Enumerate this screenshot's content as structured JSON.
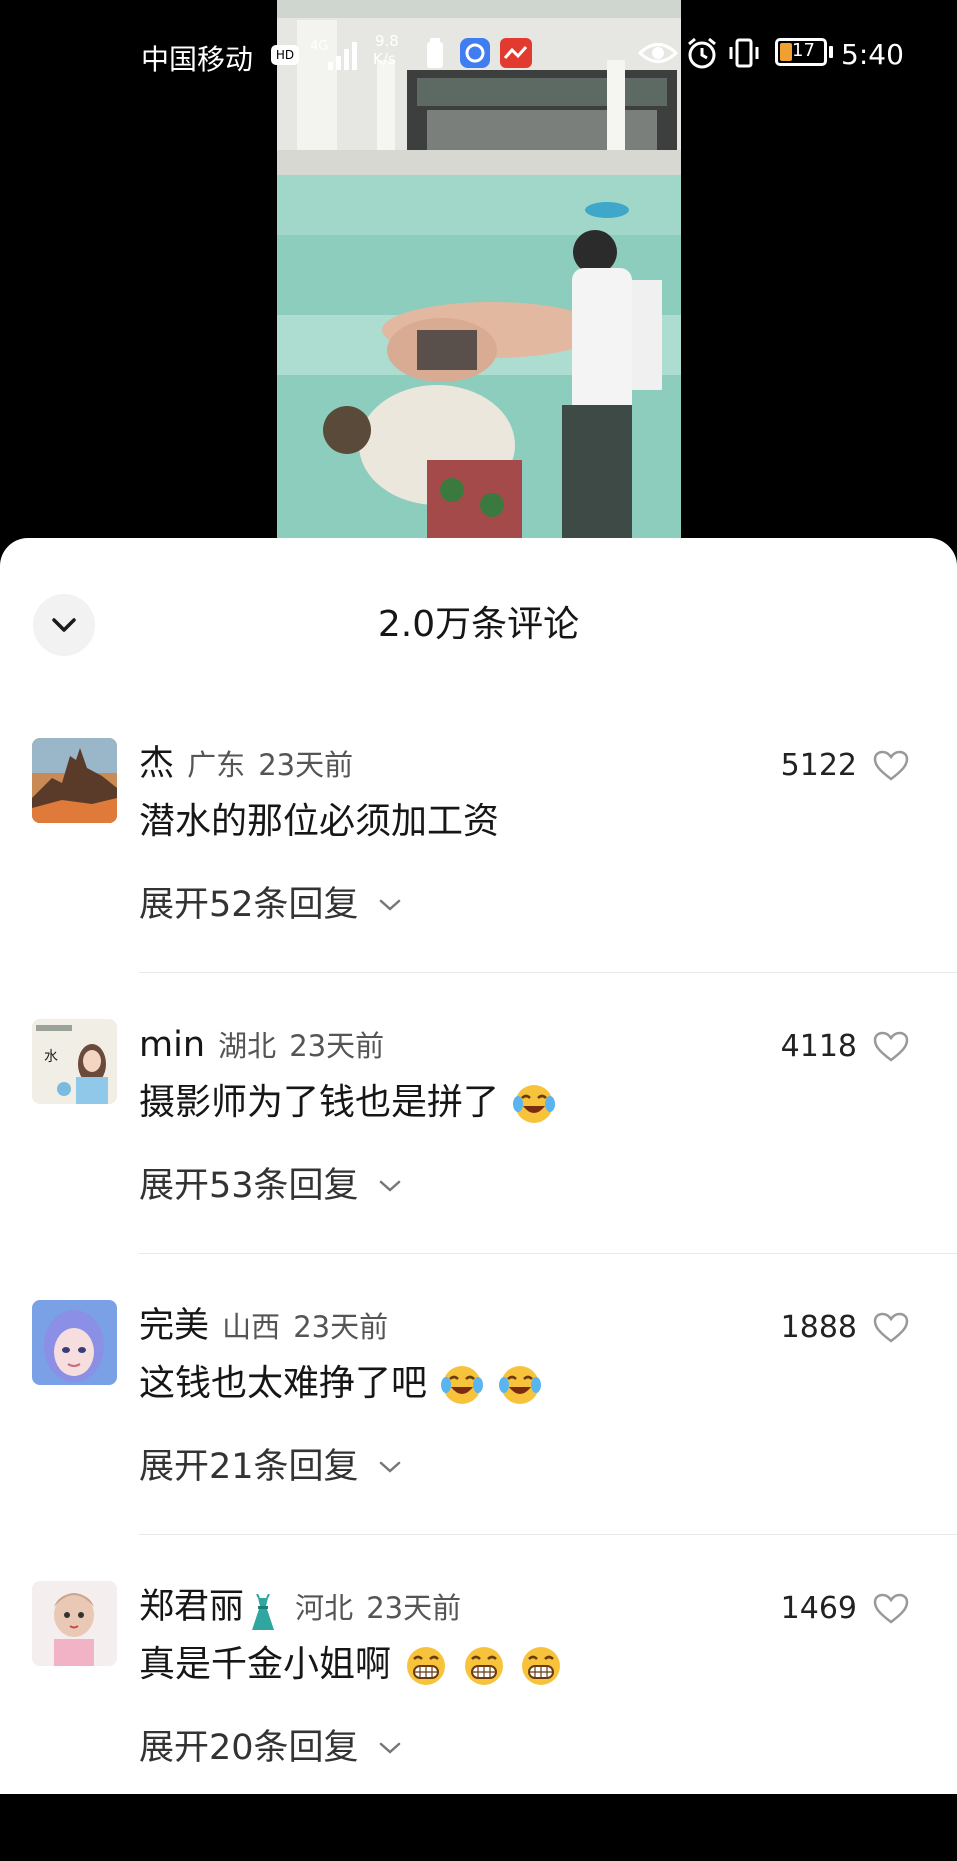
{
  "status_bar": {
    "carrier": "中国移动",
    "hd_badge": "HD",
    "network_type": "4G",
    "speed_value": "9.8",
    "speed_unit": "K/s",
    "battery_level": "17",
    "time": "5:40"
  },
  "comments_panel": {
    "title": "2.0万条评论",
    "collapse_icon": "chevron-down-icon"
  },
  "comments": [
    {
      "username": "杰",
      "region": "广东",
      "time_ago": "23天前",
      "likes": "5122",
      "text": "潜水的那位必须加工资",
      "text_emojis": [],
      "replies_label": "展开52条回复",
      "avatar": "desert-rock-landscape"
    },
    {
      "username": "min",
      "region": "湖北",
      "time_ago": "23天前",
      "likes": "4118",
      "text": "摄影师为了钱也是拼了",
      "text_emojis": [
        "laughing-crying-emoji"
      ],
      "replies_label": "展开53条回复",
      "avatar": "illustrated-girl"
    },
    {
      "username": "完美",
      "region": "山西",
      "time_ago": "23天前",
      "likes": "1888",
      "text": "这钱也太难挣了吧",
      "text_emojis": [
        "laughing-crying-emoji",
        "laughing-crying-emoji"
      ],
      "replies_label": "展开21条回复",
      "avatar": "anime-girl-blue"
    },
    {
      "username": "郑君丽",
      "username_emoji": "dress-emoji",
      "region": "河北",
      "time_ago": "23天前",
      "likes": "1469",
      "text": "真是千金小姐啊",
      "text_emojis": [
        "grinning-emoji",
        "grinning-emoji",
        "grinning-emoji"
      ],
      "replies_label": "展开20条回复",
      "avatar": "doll-girl"
    }
  ],
  "colors": {
    "sheet_bg": "#ffffff",
    "text_primary": "#161616",
    "text_secondary": "#555555",
    "divider": "#e9e9e9",
    "pool_water": "#8fcfc0"
  }
}
